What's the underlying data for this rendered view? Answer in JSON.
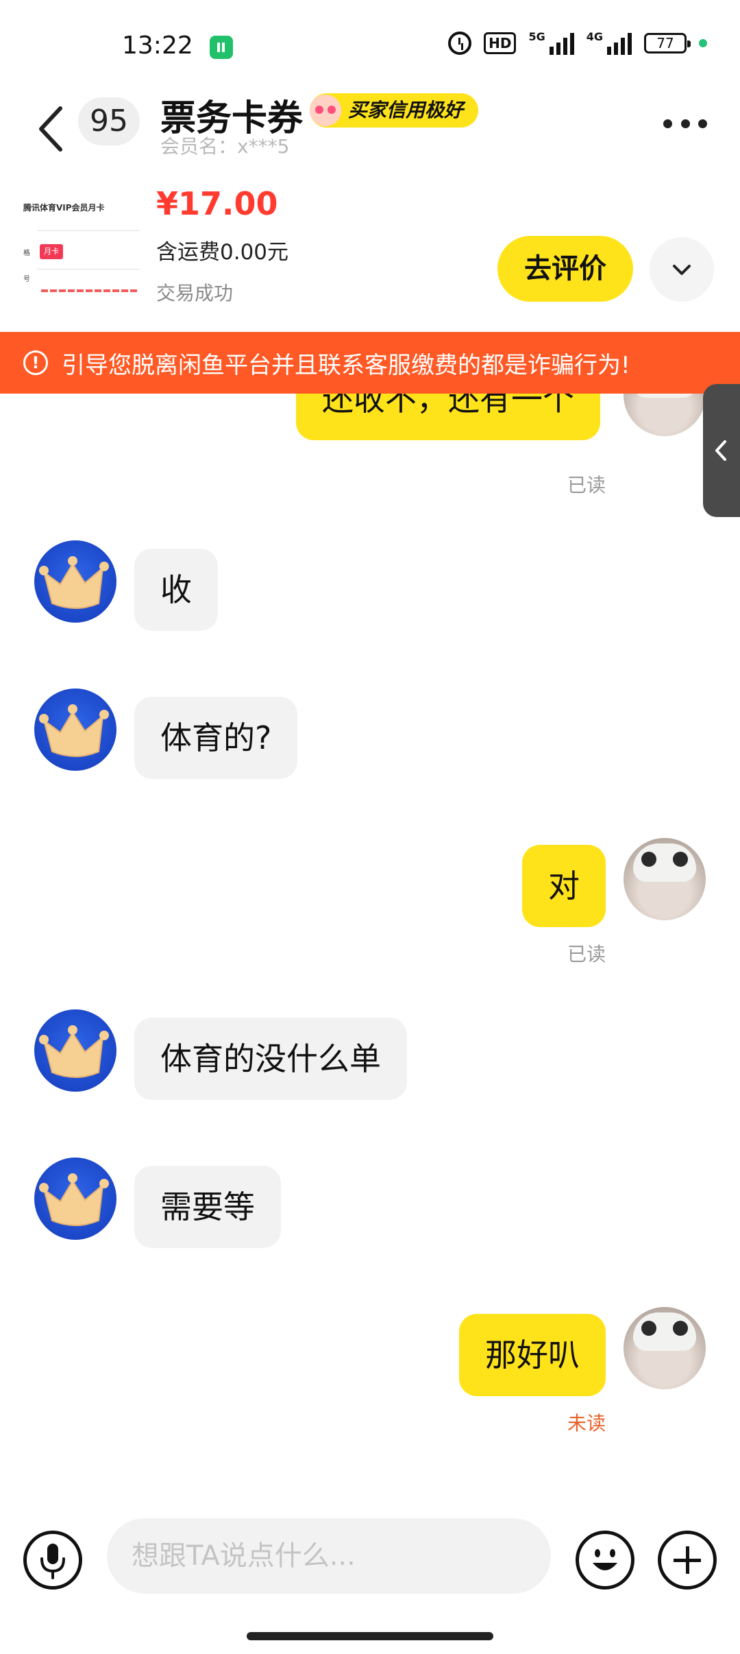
{
  "status_bar": {
    "time": "13:22",
    "hd_label": "HD",
    "signal_1_label": "5G",
    "signal_2_label": "4G",
    "battery": "77"
  },
  "header": {
    "unread_count": "95",
    "title": "票务卡券",
    "credit_badge": "买家信用极好",
    "member_name": "会员名：x***5"
  },
  "product": {
    "thumbnail_title": "腾讯体育VIP会员月卡",
    "thumbnail_tag": "月卡",
    "thumbnail_label_1": "格",
    "thumbnail_label_2": "号",
    "price": "¥17.00",
    "shipping": "含运费0.00元",
    "status": "交易成功",
    "review_button": "去评价"
  },
  "warning": {
    "text": "引导您脱离闲鱼平台并且联系客服缴费的都是诈骗行为!"
  },
  "messages": [
    {
      "side": "out",
      "text": "还收不，还有一个",
      "status": "已读"
    },
    {
      "side": "in",
      "text": "收"
    },
    {
      "side": "in",
      "text": "体育的?"
    },
    {
      "side": "out",
      "text": "对",
      "status": "已读"
    },
    {
      "side": "in",
      "text": "体育的没什么单"
    },
    {
      "side": "in",
      "text": "需要等"
    },
    {
      "side": "out",
      "text": "那好叭",
      "status": "未读"
    }
  ],
  "input": {
    "placeholder": "想跟TA说点什么..."
  },
  "icons": {
    "back": "back-arrow-icon",
    "more": "more-dots-icon",
    "expand": "chevron-down-icon",
    "warning": "warning-circle-icon",
    "side_handle": "chevron-left-icon",
    "voice": "microphone-icon",
    "emoji": "smiley-icon",
    "plus": "plus-icon"
  },
  "colors": {
    "accent_yellow": "#ffe31a",
    "price_red": "#ff3b30",
    "warning_orange": "#ff5a26",
    "unread_orange": "#e8622a"
  }
}
